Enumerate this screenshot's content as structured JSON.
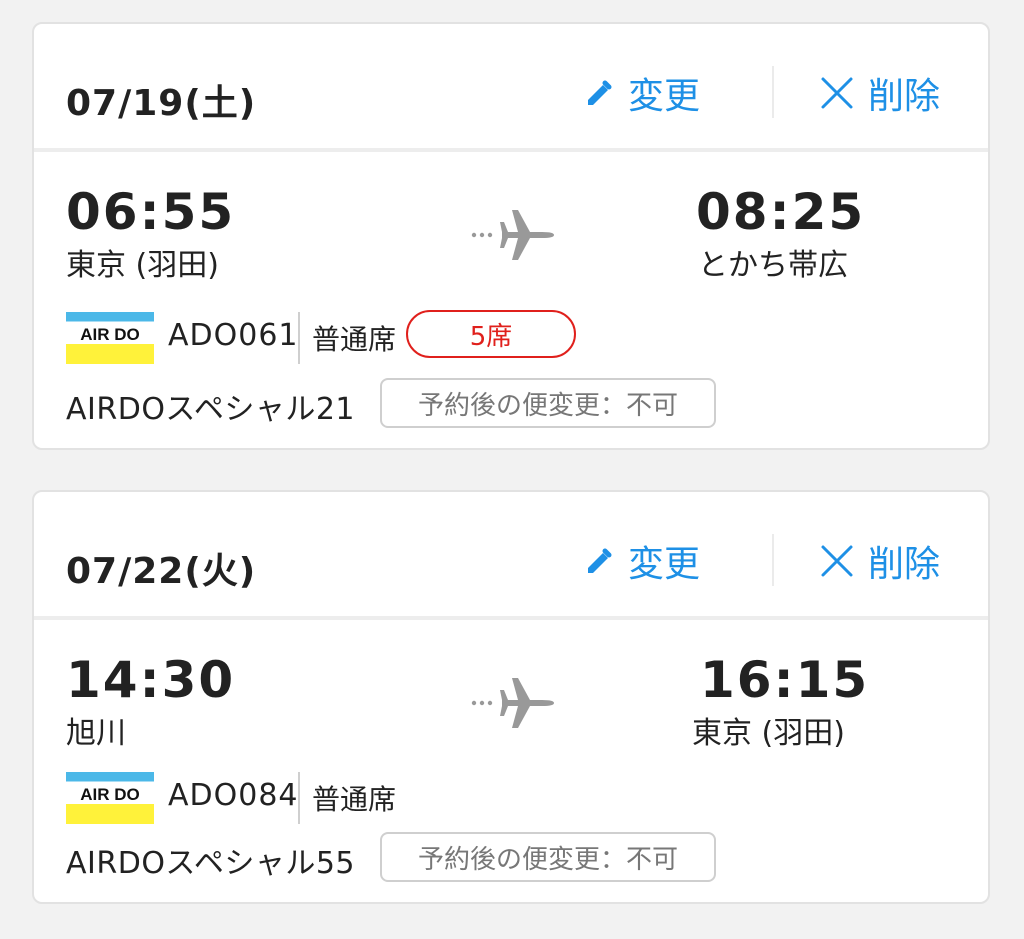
{
  "colors": {
    "accent": "#1e90e6",
    "alert": "#e0201c",
    "page_bg": "#f2f2f2"
  },
  "reservations": [
    {
      "date": "07/19(土)",
      "edit_label": "変更",
      "delete_label": "削除",
      "depart_time": "06:55",
      "depart_place": "東京 (羽田)",
      "arrive_time": "08:25",
      "arrive_place": "とかち帯広",
      "airline_logo": "AIR DO",
      "flight_no": "ADO061",
      "seat_class": "普通席",
      "seats_left": "5席",
      "fare_name": "AIRDOスペシャル21",
      "change_policy": "予約後の便変更：不可"
    },
    {
      "date": "07/22(火)",
      "edit_label": "変更",
      "delete_label": "削除",
      "depart_time": "14:30",
      "depart_place": "旭川",
      "arrive_time": "16:15",
      "arrive_place": "東京 (羽田)",
      "airline_logo": "AIR DO",
      "flight_no": "ADO084",
      "seat_class": "普通席",
      "fare_name": "AIRDOスペシャル55",
      "change_policy": "予約後の便変更：不可"
    }
  ]
}
